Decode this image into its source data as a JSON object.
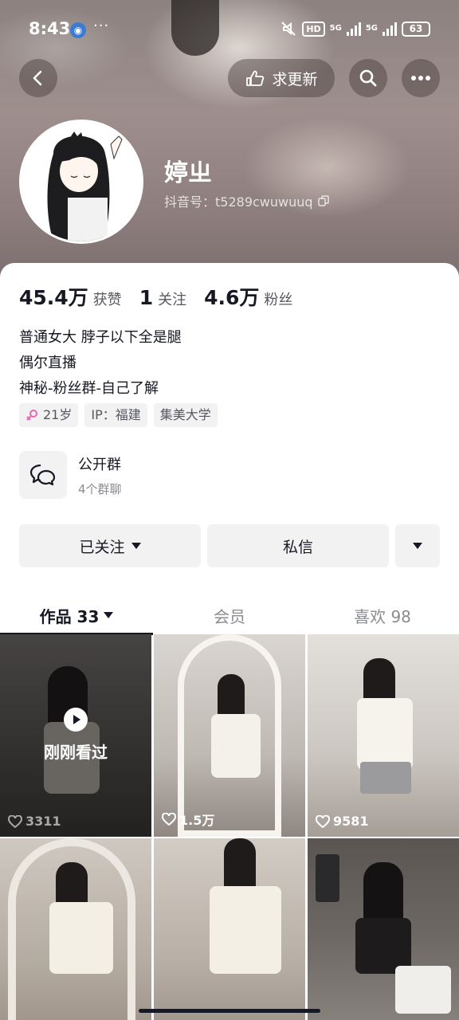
{
  "status_bar": {
    "time": "8:43",
    "hd_label": "HD",
    "net1": "5G",
    "net2": "5G",
    "battery": "63"
  },
  "header": {
    "update_label": "求更新"
  },
  "profile": {
    "username": "婷ㄓ",
    "douyin_id": "抖音号：t5289cwuwuuq"
  },
  "stats": [
    {
      "value": "45.4万",
      "label": "获赞"
    },
    {
      "value": "1",
      "label": "关注"
    },
    {
      "value": "4.6万",
      "label": "粉丝"
    }
  ],
  "bio": [
    "普通女大 脖子以下全是腿",
    "偶尔直播",
    "神秘-粉丝群-自己了解"
  ],
  "tags": {
    "age": "21岁",
    "ip": "IP：福建",
    "school": "集美大学"
  },
  "group": {
    "title": "公开群",
    "subtitle": "4个群聊"
  },
  "actions": {
    "follow_label": "已关注",
    "message_label": "私信"
  },
  "tabs": {
    "works": "作品 33",
    "member": "会员",
    "likes": "喜欢 98"
  },
  "videos": [
    {
      "likes": "3311",
      "watched_label": "刚刚看过"
    },
    {
      "likes": "1.5万"
    },
    {
      "likes": "9581"
    },
    {
      "likes": ""
    },
    {
      "likes": ""
    },
    {
      "likes": ""
    }
  ],
  "colors": {
    "accent_female": "#e668b3",
    "text_primary": "#161823",
    "text_secondary": "#8a8b91"
  }
}
